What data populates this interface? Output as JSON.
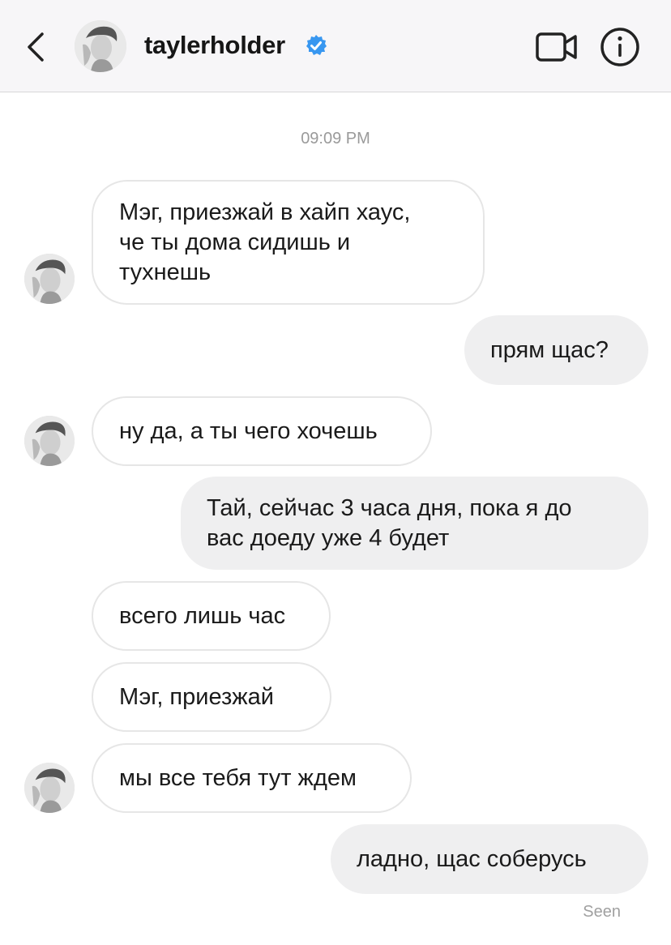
{
  "header": {
    "username": "taylerholder",
    "verified_color": "#3897f0",
    "icons": [
      "back-chevron-icon",
      "video-call-icon",
      "info-icon",
      "verified-badge-icon"
    ]
  },
  "timestamp": "09:09 PM",
  "messages": [
    {
      "side": "incoming",
      "text": "Мэг, приезжай в хайп хаус,\nче ты дома сидишь и\nтухнешь",
      "avatar": true
    },
    {
      "side": "outgoing",
      "text": "прям щас?"
    },
    {
      "side": "incoming",
      "text": "ну да, а ты чего хочешь",
      "avatar": true
    },
    {
      "side": "outgoing",
      "text": "Тай, сейчас 3 часа дня, пока я до\nвас доеду уже 4 будет"
    },
    {
      "side": "incoming",
      "text": "всего лишь час",
      "avatar": false
    },
    {
      "side": "incoming",
      "text": "Мэг, приезжай",
      "avatar": false
    },
    {
      "side": "incoming",
      "text": "мы все тебя тут ждем",
      "avatar": true
    },
    {
      "side": "outgoing",
      "text": "ладно, щас соберусь"
    }
  ],
  "status": "Seen"
}
